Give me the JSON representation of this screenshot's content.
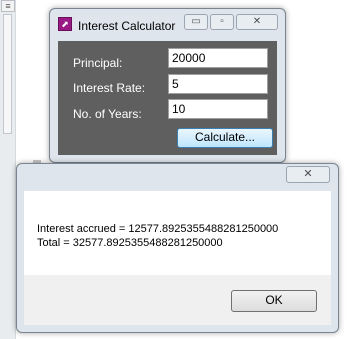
{
  "background": {
    "scroll_up_glyph": "≡"
  },
  "calculator": {
    "title": "Interest Calculator",
    "icon": "chart-icon",
    "title_buttons": {
      "minimize": "▭",
      "maximize": "▫",
      "close": "✕"
    },
    "fields": {
      "principal_label": "Principal:",
      "principal_value": "20000",
      "rate_label": "Interest Rate:",
      "rate_value": "5",
      "years_label": "No. of Years:",
      "years_value": "10"
    },
    "calculate_label": "Calculate..."
  },
  "message_box": {
    "close_glyph": "✕",
    "line1": "Interest accrued = 12577.8925355488281250000",
    "line2": "Total = 32577.8925355488281250000",
    "ok_label": "OK"
  },
  "colors": {
    "client_bg": "#5f5f5f",
    "frame": "#dfe5ec",
    "button_accent": "#3c7fb1",
    "app_icon": "#9a1a85"
  }
}
